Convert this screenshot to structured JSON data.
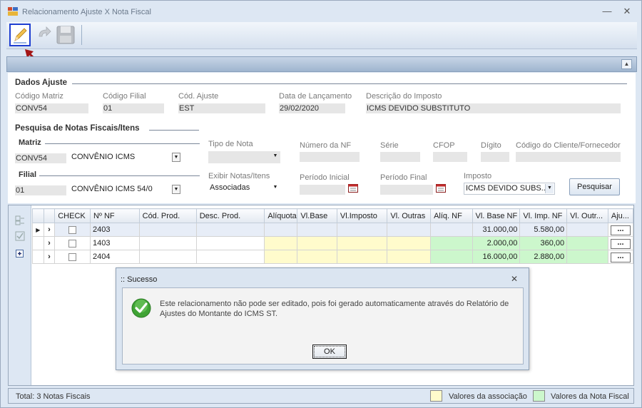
{
  "window": {
    "title": "Relacionamento Ajuste X Nota Fiscal",
    "minimize": "—",
    "close": "✕"
  },
  "dados_ajuste": {
    "title": "Dados Ajuste",
    "codigo_matriz": {
      "label": "Código Matriz",
      "value": "CONV54"
    },
    "codigo_filial": {
      "label": "Código Filial",
      "value": "01"
    },
    "cod_ajuste": {
      "label": "Cód. Ajuste",
      "value": "EST"
    },
    "data_lancamento": {
      "label": "Data de Lançamento",
      "value": "29/02/2020"
    },
    "descricao_imposto": {
      "label": "Descrição do Imposto",
      "value": "ICMS DEVIDO SUBSTITUTO"
    }
  },
  "pesquisa": {
    "title": "Pesquisa de Notas Fiscais/Itens",
    "matriz": {
      "label": "Matriz",
      "code": "CONV54",
      "name": "CONVÊNIO ICMS"
    },
    "filial": {
      "label": "Filial",
      "code": "01",
      "name": "CONVÊNIO ICMS 54/0"
    },
    "tipo_nota": {
      "label": "Tipo de Nota",
      "value": ""
    },
    "exibir_notas": {
      "label": "Exibir Notas/Itens",
      "value": "Associadas"
    },
    "numero_nf": {
      "label": "Número da NF",
      "value": ""
    },
    "serie": {
      "label": "Série",
      "value": ""
    },
    "cfop": {
      "label": "CFOP",
      "value": ""
    },
    "digito": {
      "label": "Dígito",
      "value": ""
    },
    "codigo_cliente": {
      "label": "Código do Cliente/Fornecedor",
      "value": ""
    },
    "periodo_inicial": {
      "label": "Período Inicial",
      "value": ""
    },
    "periodo_final": {
      "label": "Período Final",
      "value": ""
    },
    "imposto": {
      "label": "Imposto",
      "value": "ICMS DEVIDO SUBS..."
    },
    "pesquisar_label": "Pesquisar"
  },
  "grid": {
    "columns": [
      "CHECK",
      "Nº NF",
      "Cód. Prod.",
      "Desc. Prod.",
      "Alíquota",
      "Vl.Base",
      "Vl.Imposto",
      "Vl. Outras",
      "Alíq. NF",
      "Vl. Base NF",
      "Vl. Imp. NF",
      "Vl. Outr...",
      "Aju..."
    ],
    "rows": [
      {
        "nf": "2403",
        "vl_base_nf": "31.000,00",
        "vl_imp_nf": "5.580,00"
      },
      {
        "nf": "1403",
        "vl_base_nf": "2.000,00",
        "vl_imp_nf": "360,00"
      },
      {
        "nf": "2404",
        "vl_base_nf": "16.000,00",
        "vl_imp_nf": "2.880,00"
      }
    ],
    "row_marker": "▶",
    "expander": "›",
    "dots": "..."
  },
  "status": {
    "total": "Total: 3 Notas Fiscais",
    "legend_assoc": "Valores da associação",
    "legend_nf": "Valores da Nota Fiscal",
    "color_assoc": "#fffbcc",
    "color_nf": "#ccf7cc"
  },
  "dialog": {
    "title": ":: Sucesso",
    "close": "✕",
    "message": "Este relacionamento não pode ser editado, pois foi gerado automaticamente através do Relatório de Ajustes do Montante do ICMS ST.",
    "ok_label": "OK"
  }
}
